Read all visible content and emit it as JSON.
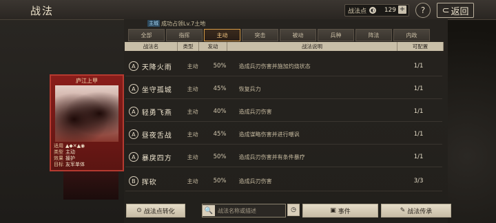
{
  "header": {
    "title": "战法",
    "points_label": "战法点",
    "points_value": "129",
    "plus": "+",
    "help": "?",
    "back_label": "返回",
    "back_icon": "⊂"
  },
  "requirement": {
    "tag": "主城",
    "text": "成功占领Lv.7土地"
  },
  "tabs": [
    {
      "label": "全部",
      "active": false
    },
    {
      "label": "指挥",
      "active": false
    },
    {
      "label": "主动",
      "active": true
    },
    {
      "label": "突击",
      "active": false
    },
    {
      "label": "被动",
      "active": false
    },
    {
      "label": "兵种",
      "active": false
    },
    {
      "label": "阵法",
      "active": false
    },
    {
      "label": "内政",
      "active": false
    }
  ],
  "columns": {
    "name": "战法名",
    "type": "类型",
    "rate": "发动",
    "desc": "战法说明",
    "count": "可配置"
  },
  "skills": [
    {
      "grade": "A",
      "name": "天降火雨",
      "type": "主动",
      "rate": "50%",
      "desc": "造成兵刃伤害并施加灼烧状态",
      "count": "1/1"
    },
    {
      "grade": "A",
      "name": "坐守孤城",
      "type": "主动",
      "rate": "45%",
      "desc": "恢复兵力",
      "count": "1/1"
    },
    {
      "grade": "A",
      "name": "轻勇飞燕",
      "type": "主动",
      "rate": "40%",
      "desc": "造成兵刃伤害",
      "count": "1/1"
    },
    {
      "grade": "A",
      "name": "昼夜舌战",
      "type": "主动",
      "rate": "45%",
      "desc": "造成谋略伤害并进行嘲讽",
      "count": "1/1"
    },
    {
      "grade": "A",
      "name": "暴戾四方",
      "type": "主动",
      "rate": "50%",
      "desc": "造成兵刃伤害并有条件暴疗",
      "count": "1/1"
    },
    {
      "grade": "B",
      "name": "挥砍",
      "type": "主动",
      "rate": "50%",
      "desc": "造成兵刃伤害",
      "count": "3/3"
    }
  ],
  "card": {
    "name": "庐江上甲",
    "info": [
      {
        "k": "适用",
        "v": "▲◆✕▲◉"
      },
      {
        "k": "类型",
        "v": "主动"
      },
      {
        "k": "效果",
        "v": "援护"
      },
      {
        "k": "目标",
        "v": "友军单体"
      }
    ]
  },
  "buttons": {
    "convert": "战法点转化",
    "convert_icon": "⊙",
    "search_placeholder": "战法名称或描述",
    "search_icon": "🔍",
    "clock_icon": "◷",
    "event": "事件",
    "event_icon": "▣",
    "inherit": "战法传承",
    "inherit_icon": "✎"
  }
}
